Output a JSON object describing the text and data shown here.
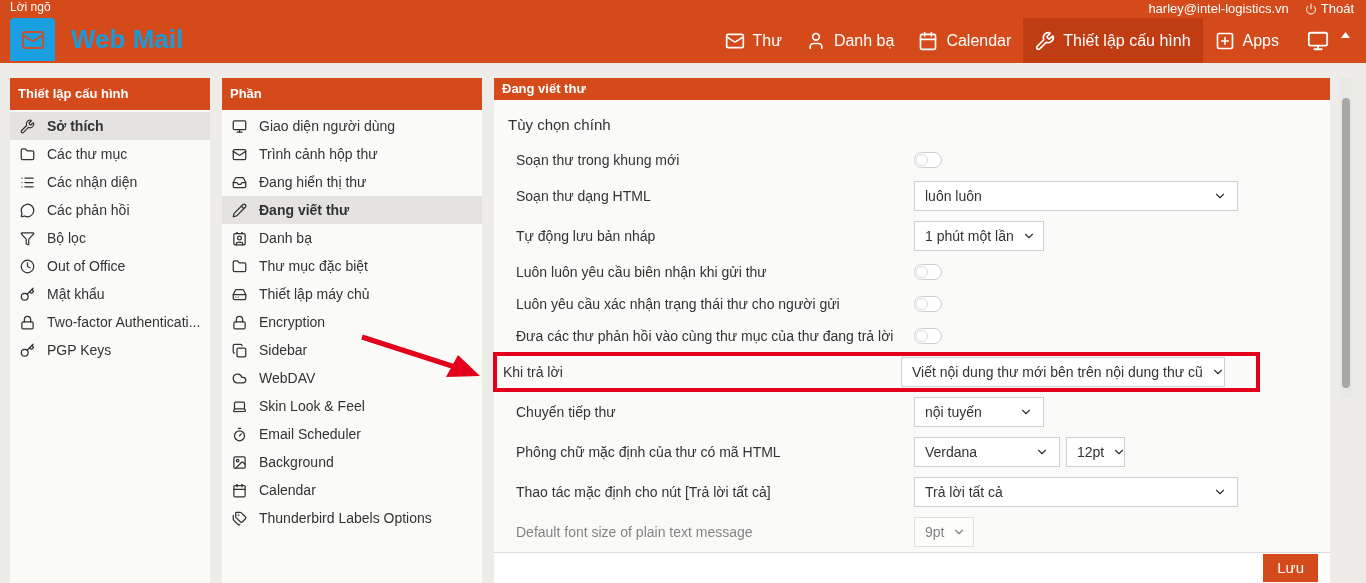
{
  "header": {
    "tagline": "Lời ngõ",
    "user_email": "harley@intel-logistics.vn",
    "logout": "Thoát",
    "logo_text": "Web Mail",
    "nav": [
      {
        "label": "Thư",
        "selected": false
      },
      {
        "label": "Danh bạ",
        "selected": false
      },
      {
        "label": "Calendar",
        "selected": false
      },
      {
        "label": "Thiết lập cấu hình",
        "selected": true
      },
      {
        "label": "Apps",
        "selected": false
      }
    ]
  },
  "settings_menu": {
    "title": "Thiết lập cấu hình",
    "items": [
      {
        "label": "Sở thích",
        "selected": true
      },
      {
        "label": "Các thư mục",
        "selected": false
      },
      {
        "label": "Các nhận diện",
        "selected": false
      },
      {
        "label": "Các phản hồi",
        "selected": false
      },
      {
        "label": "Bộ lọc",
        "selected": false
      },
      {
        "label": "Out of Office",
        "selected": false
      },
      {
        "label": "Mật khẩu",
        "selected": false
      },
      {
        "label": "Two-factor Authenticati...",
        "selected": false
      },
      {
        "label": "PGP Keys",
        "selected": false
      }
    ]
  },
  "sections": {
    "title": "Phần",
    "items": [
      {
        "label": "Giao diện người dùng",
        "selected": false
      },
      {
        "label": "Trình cảnh hộp thư",
        "selected": false
      },
      {
        "label": "Đang hiển thị thư",
        "selected": false
      },
      {
        "label": "Đang viết thư",
        "selected": true
      },
      {
        "label": "Danh bạ",
        "selected": false
      },
      {
        "label": "Thư mục đặc biệt",
        "selected": false
      },
      {
        "label": "Thiết lập máy chủ",
        "selected": false
      },
      {
        "label": "Encryption",
        "selected": false
      },
      {
        "label": "Sidebar",
        "selected": false
      },
      {
        "label": "WebDAV",
        "selected": false
      },
      {
        "label": "Skin Look & Feel",
        "selected": false
      },
      {
        "label": "Email Scheduler",
        "selected": false
      },
      {
        "label": "Background",
        "selected": false
      },
      {
        "label": "Calendar",
        "selected": false
      },
      {
        "label": "Thunderbird Labels Options",
        "selected": false
      }
    ]
  },
  "composing": {
    "title": "Đang viết thư",
    "group_title": "Tùy chọn chính",
    "rows": [
      {
        "kind": "toggle",
        "label": "Soạn thư trong khung mới",
        "on": false,
        "highlighted": false,
        "dimmed": false
      },
      {
        "kind": "select",
        "label": "Soạn thư dạng HTML",
        "values": [
          "luôn luôn"
        ],
        "highlighted": false,
        "dimmed": false
      },
      {
        "kind": "select",
        "label": "Tự động lưu bản nháp",
        "values": [
          "1 phút một lần"
        ],
        "highlighted": false,
        "dimmed": false
      },
      {
        "kind": "toggle",
        "label": "Luôn luôn yêu cầu biên nhận khi gửi thư",
        "on": false,
        "highlighted": false,
        "dimmed": false
      },
      {
        "kind": "toggle",
        "label": "Luôn yêu cầu xác nhận trạng thái thư cho người gửi",
        "on": false,
        "highlighted": false,
        "dimmed": false
      },
      {
        "kind": "toggle",
        "label": "Đưa các thư phản hồi vào cùng thư mục của thư đang trả lời",
        "on": false,
        "highlighted": false,
        "dimmed": false
      },
      {
        "kind": "select",
        "label": "Khi trả lời",
        "values": [
          "Viết nội dung thư mới bên trên nội dung thư cũ"
        ],
        "highlighted": true,
        "dimmed": false
      },
      {
        "kind": "select",
        "label": "Chuyển tiếp thư",
        "values": [
          "nội tuyến"
        ],
        "highlighted": false,
        "dimmed": false
      },
      {
        "kind": "select",
        "label": "Phông chữ mặc định của thư có mã HTML",
        "values": [
          "Verdana",
          "12pt"
        ],
        "highlighted": false,
        "dimmed": false
      },
      {
        "kind": "select",
        "label": "Thao tác mặc định cho nút [Trả lời tất cả]",
        "values": [
          "Trả lời tất cả"
        ],
        "highlighted": false,
        "dimmed": false
      },
      {
        "kind": "select",
        "label": "Default font size of plain text message",
        "values": [
          "9pt"
        ],
        "highlighted": false,
        "dimmed": true
      }
    ],
    "save_button": "Lưu"
  }
}
